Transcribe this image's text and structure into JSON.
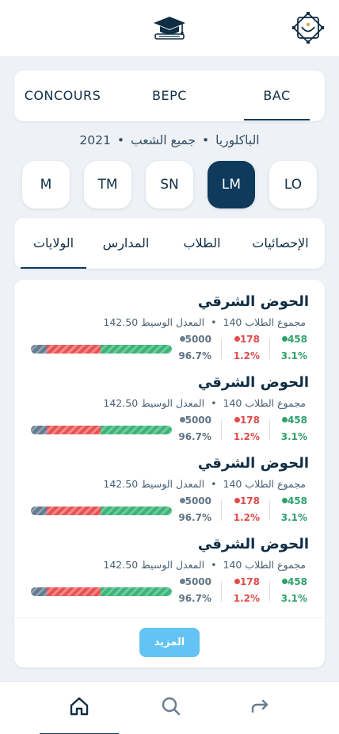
{
  "header": {
    "logo_icon": "graduation-cap-icon",
    "emblem_icon": "emblem-icon"
  },
  "exam_tabs": [
    {
      "label": "CONCOURS",
      "active": false
    },
    {
      "label": "BEPC",
      "active": false
    },
    {
      "label": "BAC",
      "active": true
    }
  ],
  "subtitle": {
    "exam": "الباكلوريا",
    "track": "جميع الشعب",
    "year": "2021",
    "separator": "•"
  },
  "series": [
    {
      "label": "M",
      "active": false
    },
    {
      "label": "TM",
      "active": false
    },
    {
      "label": "SN",
      "active": false
    },
    {
      "label": "LM",
      "active": true
    },
    {
      "label": "LO",
      "active": false
    }
  ],
  "sub_tabs": [
    {
      "label": "الولايات",
      "active": true
    },
    {
      "label": "المدارس",
      "active": false
    },
    {
      "label": "الطلاب",
      "active": false
    },
    {
      "label": "الإحصائيات",
      "active": false
    }
  ],
  "regions": [
    {
      "name": "الحوض الشرقي",
      "total_label": "مجموع الطلاب 140",
      "avg_label": "المعدل الوسيط 142.50",
      "admitted": "458",
      "admitted_pct": "3.1%",
      "session": "178",
      "session_pct": "1.2%",
      "failed": "5000",
      "failed_pct": "96.7%"
    },
    {
      "name": "الحوض الشرقي",
      "total_label": "مجموع الطلاب 140",
      "avg_label": "المعدل الوسيط 142.50",
      "admitted": "458",
      "admitted_pct": "3.1%",
      "session": "178",
      "session_pct": "1.2%",
      "failed": "5000",
      "failed_pct": "96.7%"
    },
    {
      "name": "الحوض الشرقي",
      "total_label": "مجموع الطلاب 140",
      "avg_label": "المعدل الوسيط 142.50",
      "admitted": "458",
      "admitted_pct": "3.1%",
      "session": "178",
      "session_pct": "1.2%",
      "failed": "5000",
      "failed_pct": "96.7%"
    },
    {
      "name": "الحوض الشرقي",
      "total_label": "مجموع الطلاب 140",
      "avg_label": "المعدل الوسيط 142.50",
      "admitted": "458",
      "admitted_pct": "3.1%",
      "session": "178",
      "session_pct": "1.2%",
      "failed": "5000",
      "failed_pct": "96.7%"
    }
  ],
  "bar_shares": {
    "admitted": 0.51,
    "session": 0.38,
    "failed": 0.11
  },
  "more_label": "المزيد",
  "bottom_nav": [
    {
      "icon": "home-icon",
      "active": true
    },
    {
      "icon": "search-icon",
      "active": false
    },
    {
      "icon": "share-icon",
      "active": false
    }
  ],
  "colors": {
    "primary": "#0e3a5c",
    "admitted": "#2ea16a",
    "session": "#e04b4b",
    "failed": "#607485",
    "more_button": "#63c3f2"
  }
}
